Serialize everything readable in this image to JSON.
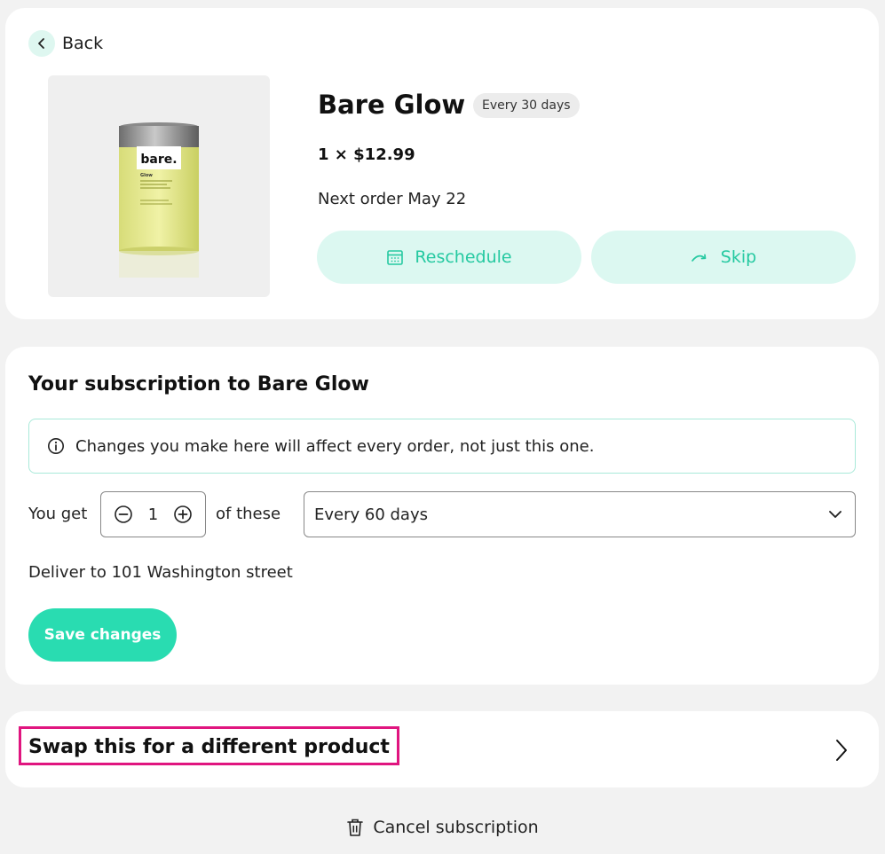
{
  "nav": {
    "back_label": "Back"
  },
  "product": {
    "image_brand_text": "bare.",
    "image_variant_text": "Glow",
    "title": "Bare Glow",
    "frequency_badge": "Every 30 days",
    "quantity_price": "1 × $12.99",
    "next_order": "Next order May 22",
    "reschedule_label": "Reschedule",
    "skip_label": "Skip"
  },
  "subscription": {
    "heading": "Your subscription to Bare Glow",
    "notice": "Changes you make here will affect every order, not just this one.",
    "you_get_label": "You get",
    "quantity_value": "1",
    "of_these_label": "of these",
    "frequency_value": "Every 60 days",
    "deliver_to": "Deliver to 101 Washington street",
    "save_label": "Save changes"
  },
  "swap": {
    "label": "Swap this for a different product"
  },
  "cancel": {
    "label": "Cancel subscription"
  },
  "colors": {
    "accent": "#29dcb1",
    "accent_text": "#25c9a1",
    "accent_light": "#dcf8f1",
    "highlight_border": "#e0157f",
    "page_background": "#f2f2f2"
  },
  "icons": {
    "back": "chevron-left-icon",
    "reschedule": "calendar-icon",
    "skip": "skip-arrow-icon",
    "notice": "info-icon",
    "decrement": "minus-circle-icon",
    "increment": "plus-circle-icon",
    "select": "chevron-down-icon",
    "swap": "chevron-right-icon",
    "cancel": "trash-icon"
  }
}
